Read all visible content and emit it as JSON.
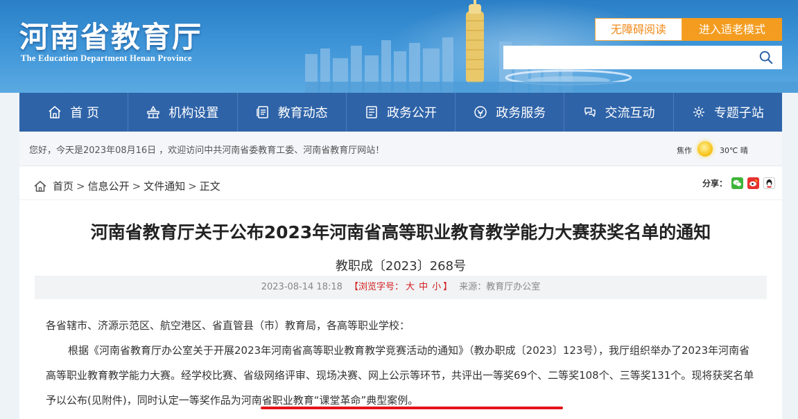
{
  "header": {
    "title": "河南省教育厅",
    "subtitle": "The Education Department Henan Province",
    "accessibility_label": "无障碍阅读",
    "elder_mode_label": "进入适老模式",
    "search_placeholder": ""
  },
  "nav": {
    "items": [
      {
        "label": "首 页",
        "icon": "home-icon"
      },
      {
        "label": "机构设置",
        "icon": "org-icon"
      },
      {
        "label": "教育动态",
        "icon": "news-icon"
      },
      {
        "label": "政务公开",
        "icon": "document-icon"
      },
      {
        "label": "政务服务",
        "icon": "service-icon"
      },
      {
        "label": "交流互动",
        "icon": "interaction-icon"
      },
      {
        "label": "专题子站",
        "icon": "topics-icon"
      }
    ]
  },
  "greeting": {
    "text": "您好，今天是2023年08月16日 ，欢迎访问中共河南省委教育工委、河南省教育厅网站！",
    "weather_city": "焦作",
    "weather_icon": "sun-icon",
    "weather_temp": "30℃ 晴"
  },
  "breadcrumb": {
    "home": "首页",
    "level2": "信息公开",
    "level3": "文件通知",
    "current": "正文",
    "separator": ">"
  },
  "share": {
    "label": "分享："
  },
  "article": {
    "title": "河南省教育厅关于公布2023年河南省高等职业教育教学能力大赛获奖名单的通知",
    "doc_number": "教职成〔2023〕268号",
    "date": "2023-08-14 18:18",
    "font_size_prefix": "【浏览字号：",
    "size_large": "大",
    "size_medium": "中",
    "size_small": "小",
    "font_size_suffix": "】",
    "source": "来源：教育厅办公室",
    "salutation": "各省辖市、济源示范区、航空港区、省直管县（市）教育局，各高等职业学校：",
    "paragraph_1": "根据《河南省教育厅办公室关于开展2023年河南省高等职业教育教学竞赛活动的通知》（教办职成〔2023〕123号），我厅组织举办了2023年河南省高等职业教育教学能力大赛。经学校比赛、省级网络评审、现场决赛、网上公示等环节，共评出一等奖69个、二等奖108个、三等奖131个。现将获奖名单予以公布(见附件)，同时认定一等奖作品为河南省职业教育“课堂革命”典型案例。"
  },
  "colors": {
    "nav_bg": "#2e63a8",
    "accent_orange": "#f39c1f",
    "highlight_red": "#e4141a"
  }
}
